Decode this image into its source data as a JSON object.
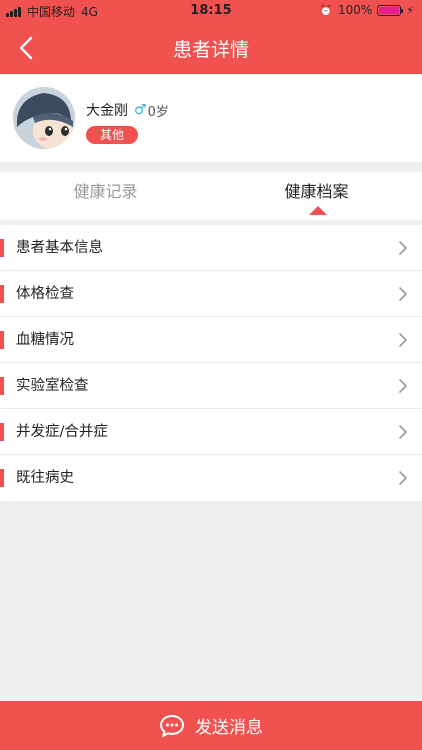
{
  "status_bar": {
    "carrier": "中国移动",
    "network": "4G",
    "time": "18:15",
    "battery_percent": "100%",
    "battery_level": 1.0
  },
  "header": {
    "title": "患者详情",
    "back_icon": "chevron-left-icon"
  },
  "patient": {
    "name": "大金刚",
    "age": "0岁",
    "gender_icon": "gender-icon",
    "tag": "其他"
  },
  "tabs": [
    {
      "label": "健康记录",
      "active": false
    },
    {
      "label": "健康档案",
      "active": true
    }
  ],
  "menu_items": [
    {
      "label": "患者基本信息"
    },
    {
      "label": "体格检查"
    },
    {
      "label": "血糖情况"
    },
    {
      "label": "实验室检查"
    },
    {
      "label": "并发症/合并症"
    },
    {
      "label": "既往病史"
    }
  ],
  "bottom_button": {
    "label": "发送消息",
    "icon": "chat-bubble-icon"
  },
  "colors": {
    "accent": "#f2524f",
    "background": "#efefef",
    "gender_icon": "#33b0cc"
  }
}
